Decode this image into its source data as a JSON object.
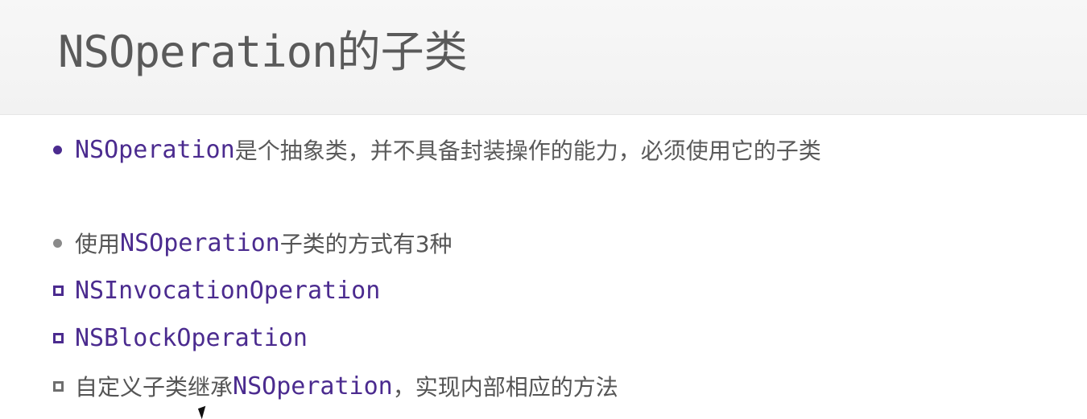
{
  "slide": {
    "title_mono": "NSOperation",
    "title_cjk": "的子类",
    "bullets": [
      {
        "code": "NSOperation",
        "text": "是个抽象类，并不具备封装操作的能力，必须使用它的子类"
      },
      {
        "text_before": "使用",
        "code": "NSOperation",
        "text_after": "子类的方式有3种"
      },
      {
        "code": "NSInvocationOperation"
      },
      {
        "code": "NSBlockOperation"
      },
      {
        "text_before": "自定义子类继承",
        "code": "NSOperation",
        "text_after": "，实现内部相应的方法"
      }
    ]
  },
  "colors": {
    "code_purple": "#4b2b8f",
    "body_gray": "#555555",
    "title_gray": "#5a5a5a"
  }
}
